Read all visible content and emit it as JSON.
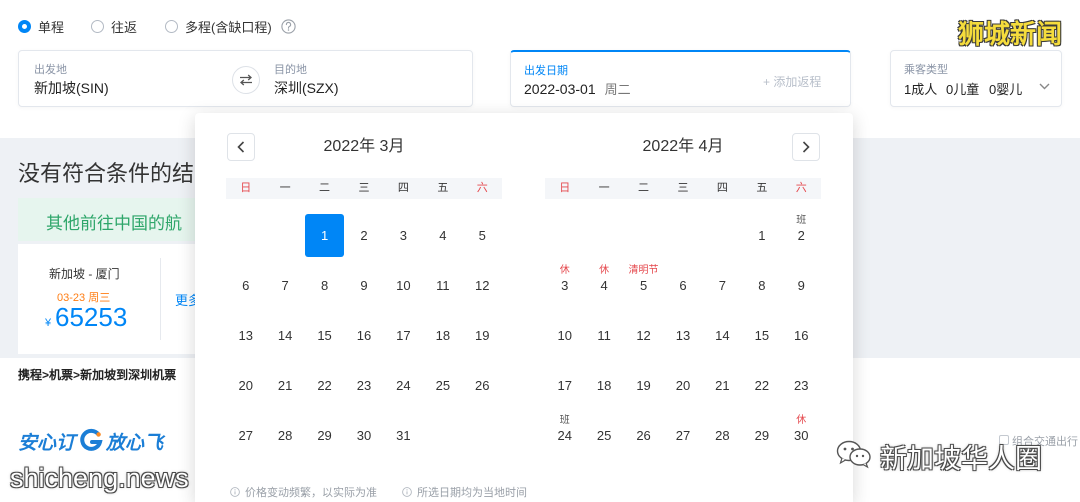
{
  "colors": {
    "accent": "#0086f6",
    "holiday": "#e5484d",
    "price": "#0086f6",
    "date_orange": "#ff7d13",
    "banner_text": "#2ea66a"
  },
  "trip_types": [
    {
      "label": "单程",
      "selected": true
    },
    {
      "label": "往返",
      "selected": false
    },
    {
      "label": "多程(含缺口程)",
      "selected": false
    }
  ],
  "icons": {
    "help": "question-circle-icon",
    "swap": "swap-arrows-icon",
    "dropdown": "chevron-down-icon",
    "prev": "chevron-left-icon",
    "next": "chevron-right-icon",
    "info": "info-circle-icon"
  },
  "search": {
    "from": {
      "label": "出发地",
      "value": "新加坡(SIN)"
    },
    "to": {
      "label": "目的地",
      "value": "深圳(SZX)"
    },
    "date": {
      "label": "出发日期",
      "value": "2022-03-01",
      "weekday": "周二",
      "add_return": "+ 添加返程"
    },
    "passengers": {
      "label": "乘客类型",
      "adults": "1成人",
      "children": "0儿童",
      "infants": "0婴儿"
    }
  },
  "calendar": {
    "weekdays": [
      "日",
      "一",
      "二",
      "三",
      "四",
      "五",
      "六"
    ],
    "months": [
      {
        "title": "2022年 3月",
        "selected_day": 1,
        "weeks": [
          [
            null,
            null,
            1,
            2,
            3,
            4,
            5
          ],
          [
            6,
            7,
            8,
            9,
            10,
            11,
            12
          ],
          [
            13,
            14,
            15,
            16,
            17,
            18,
            19
          ],
          [
            20,
            21,
            22,
            23,
            24,
            25,
            26
          ],
          [
            27,
            28,
            29,
            30,
            31,
            null,
            null
          ]
        ],
        "tags": {}
      },
      {
        "title": "2022年 4月",
        "selected_day": null,
        "weeks": [
          [
            null,
            null,
            null,
            null,
            null,
            1,
            2
          ],
          [
            3,
            4,
            5,
            6,
            7,
            8,
            9
          ],
          [
            10,
            11,
            12,
            13,
            14,
            15,
            16
          ],
          [
            17,
            18,
            19,
            20,
            21,
            22,
            23
          ],
          [
            24,
            25,
            26,
            27,
            28,
            29,
            30
          ]
        ],
        "tags": {
          "2": {
            "text": "班",
            "color": "#555555"
          },
          "3": {
            "text": "休",
            "color": "#e5484d"
          },
          "4": {
            "text": "休",
            "color": "#e5484d"
          },
          "5": {
            "text": "清明节",
            "color": "#e5484d"
          },
          "24": {
            "text": "班",
            "color": "#555555"
          },
          "30": {
            "text": "休",
            "color": "#e5484d"
          }
        }
      }
    ],
    "notes": [
      "价格变动频繁，以实际为准",
      "所选日期均为当地时间"
    ]
  },
  "results": {
    "heading": "没有符合条件的结",
    "banner": "其他前往中国的航",
    "card": {
      "route": "新加坡 - 厦门",
      "date": "03-23",
      "weekday": "周三",
      "currency": "¥",
      "price": "65253",
      "more": "更多"
    }
  },
  "breadcrumb": {
    "items": [
      "携程",
      "机票",
      "新加坡到深圳机票"
    ],
    "separator": ">"
  },
  "promo": {
    "left": "安心订",
    "right": "放心飞",
    "side": "组合交通出行"
  },
  "watermarks": {
    "top_right": "狮城新闻",
    "bottom_left": "shicheng.news",
    "bottom_right": "新加坡华人圈"
  }
}
